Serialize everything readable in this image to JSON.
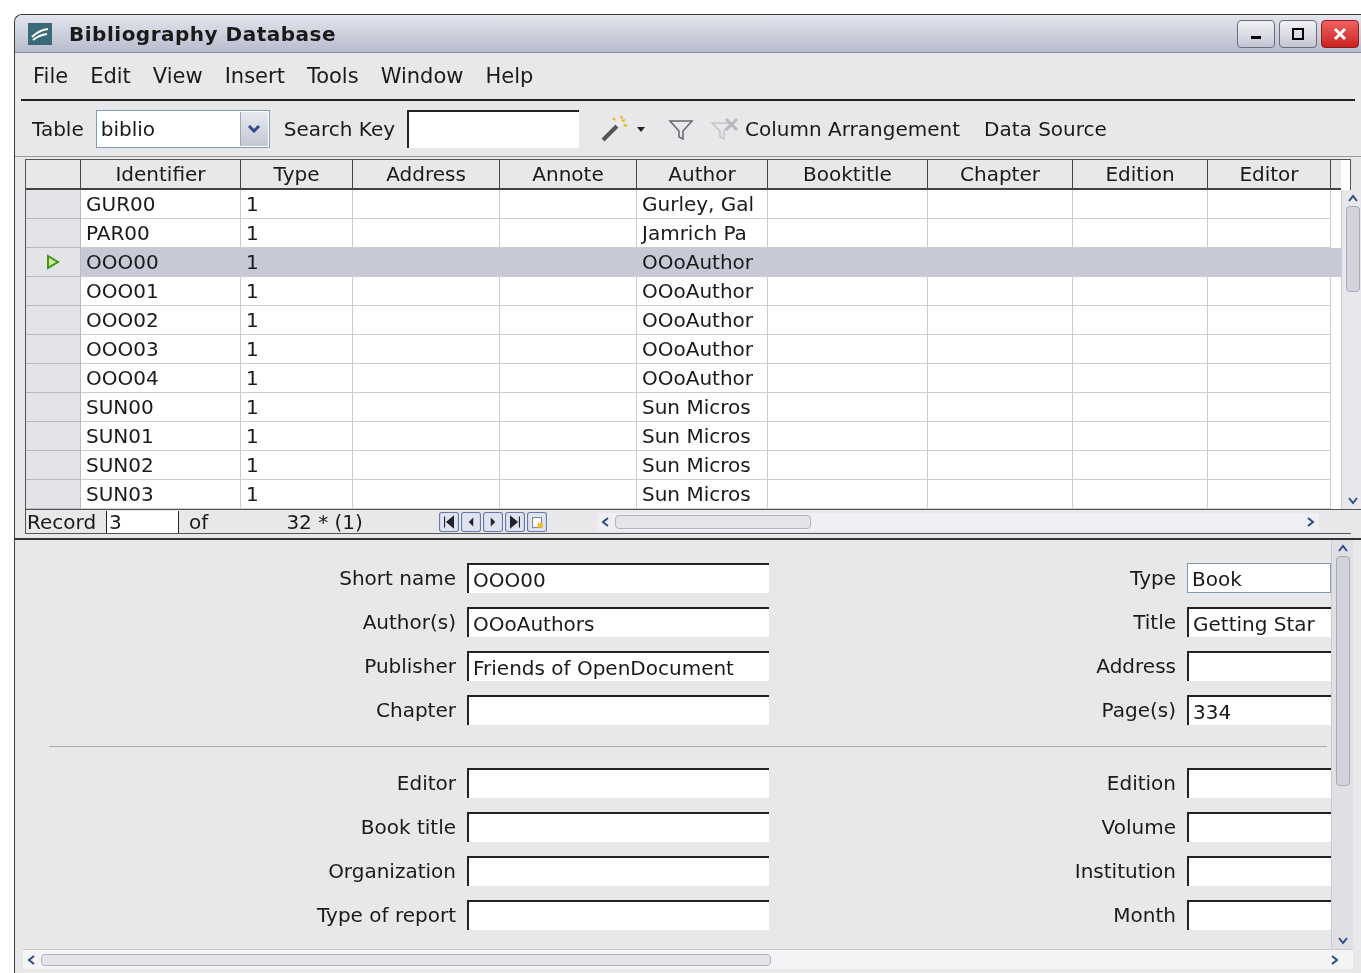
{
  "window": {
    "title": "Bibliography Database"
  },
  "menu": [
    "File",
    "Edit",
    "View",
    "Insert",
    "Tools",
    "Window",
    "Help"
  ],
  "toolbar": {
    "table_label": "Table",
    "table_value": "biblio",
    "search_label": "Search Key",
    "buttons": [
      "Column Arrangement",
      "Data Source"
    ]
  },
  "grid": {
    "columns": [
      "Identifier",
      "Type",
      "Address",
      "Annote",
      "Author",
      "Booktitle",
      "Chapter",
      "Edition",
      "Editor"
    ],
    "rows": [
      {
        "identifier": "GUR00",
        "type": "1",
        "author": "Gurley, Gal",
        "selected": false
      },
      {
        "identifier": "PAR00",
        "type": "1",
        "author": "Jamrich Pa",
        "selected": false
      },
      {
        "identifier": "OOO00",
        "type": "1",
        "author": "OOoAuthor",
        "selected": true
      },
      {
        "identifier": "OOO01",
        "type": "1",
        "author": "OOoAuthor",
        "selected": false
      },
      {
        "identifier": "OOO02",
        "type": "1",
        "author": "OOoAuthor",
        "selected": false
      },
      {
        "identifier": "OOO03",
        "type": "1",
        "author": "OOoAuthor",
        "selected": false
      },
      {
        "identifier": "OOO04",
        "type": "1",
        "author": "OOoAuthor",
        "selected": false
      },
      {
        "identifier": "SUN00",
        "type": "1",
        "author": "Sun Micros",
        "selected": false
      },
      {
        "identifier": "SUN01",
        "type": "1",
        "author": "Sun Micros",
        "selected": false
      },
      {
        "identifier": "SUN02",
        "type": "1",
        "author": "Sun Micros",
        "selected": false
      },
      {
        "identifier": "SUN03",
        "type": "1",
        "author": "Sun Micros",
        "selected": false
      }
    ]
  },
  "record_bar": {
    "label": "Record",
    "value": "3",
    "of": "of",
    "count": "32 * (1)"
  },
  "form": {
    "sections": [
      {
        "rows": [
          {
            "left": {
              "label": "Short name",
              "value": "OOO00"
            },
            "right": {
              "label": "Type",
              "value": "Book"
            }
          },
          {
            "left": {
              "label": "Author(s)",
              "value": "OOoAuthors"
            },
            "right": {
              "label": "Title",
              "value": "Getting Star"
            }
          },
          {
            "left": {
              "label": "Publisher",
              "value": "Friends of OpenDocument"
            },
            "right": {
              "label": "Address"
            }
          },
          {
            "left": {
              "label": "Chapter"
            },
            "right": {
              "label": "Page(s)",
              "value": "334"
            }
          }
        ]
      },
      {
        "rows": [
          {
            "left": {
              "label": "Editor"
            },
            "right": {
              "label": "Edition"
            }
          },
          {
            "left": {
              "label": "Book title"
            },
            "right": {
              "label": "Volume"
            }
          },
          {
            "left": {
              "label": "Organization"
            },
            "right": {
              "label": "Institution"
            }
          },
          {
            "left": {
              "label": "Type of report"
            },
            "right": {
              "label": "Month"
            }
          }
        ]
      }
    ]
  }
}
